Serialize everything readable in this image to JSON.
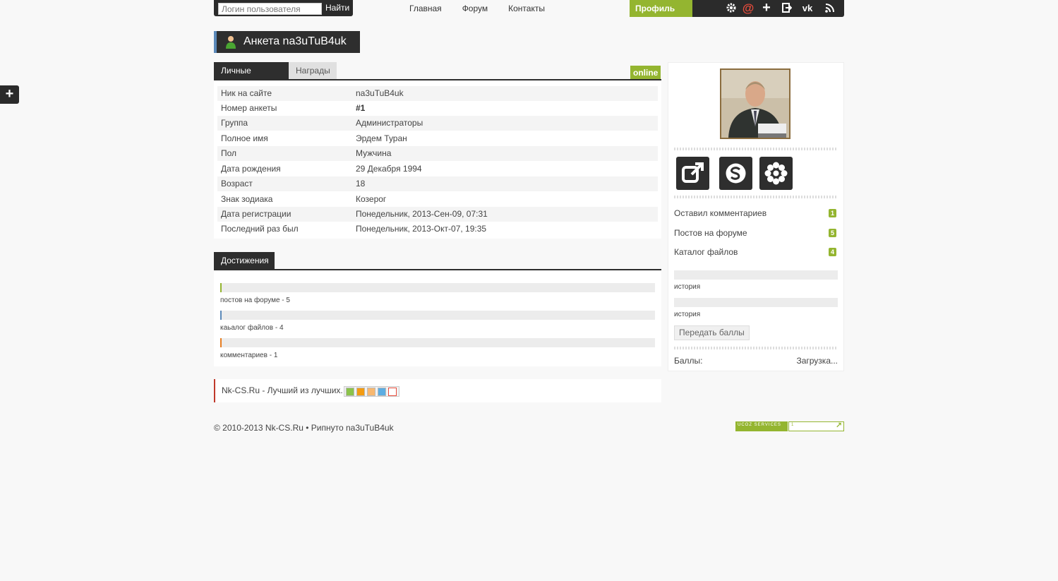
{
  "search": {
    "placeholder": "Логин пользователя",
    "button": "Найти"
  },
  "nav": [
    "Главная",
    "Форум",
    "Контакты"
  ],
  "profile_label": "Профиль",
  "header_icons": [
    "gear-icon",
    "at-icon",
    "plus-icon",
    "logout-icon",
    "vk-icon",
    "rss-icon"
  ],
  "title": "Анкета na3uTuB4uk",
  "tabs": {
    "personal": "Личные данные",
    "awards": "Награды"
  },
  "status": "online",
  "info": [
    {
      "key": "Ник на сайте",
      "value": "na3uTuB4uk"
    },
    {
      "key": "Номер анкеты",
      "value": "#1"
    },
    {
      "key": "Группа",
      "value": "Администраторы"
    },
    {
      "key": "Полное имя",
      "value": "Эрдем Туран"
    },
    {
      "key": "Пол",
      "value": "Мужчина"
    },
    {
      "key": "Дата рождения",
      "value": "29 Декабря 1994"
    },
    {
      "key": "Возраст",
      "value": "18"
    },
    {
      "key": "Знак зодиака",
      "value": "Козерог"
    },
    {
      "key": "Дата регистрации",
      "value": "Понедельник, 2013-Сен-09, 07:31"
    },
    {
      "key": "Последний раз был",
      "value": "Понедельник, 2013-Окт-07, 19:35"
    }
  ],
  "achievements": {
    "tab": "Достижения",
    "items": [
      {
        "label": "постов на форуме - 5",
        "color": "#94b530"
      },
      {
        "label": "каьалог файлов - 4",
        "color": "#5b89b9"
      },
      {
        "label": "комментариев - 1",
        "color": "#e67e22"
      }
    ]
  },
  "slogan": "Nk-CS.Ru - Лучший из лучших.",
  "footer": "© 2010-2013 Nk-CS.Ru • Рипнуто na3uTuB4uk",
  "ucoz_label": "UCOZ SERVICES",
  "ucoz_counter": "1",
  "sidebar": {
    "social_icons": [
      "external-link-icon",
      "skype-icon",
      "asterisk-icon"
    ],
    "stats": [
      {
        "label": "Оставил комментариев",
        "count": "1"
      },
      {
        "label": "Постов на форуме",
        "count": "5"
      },
      {
        "label": "Каталог файлов",
        "count": "4"
      }
    ],
    "history": [
      "история",
      "история"
    ],
    "send_points": "Передать баллы",
    "points_label": "Баллы:",
    "points_value": "Загрузка..."
  },
  "colors": {
    "accent": "#94b530",
    "dark": "#2e2e2e",
    "title_border": "#5b89b9",
    "slogan_border": "#c0392b"
  }
}
